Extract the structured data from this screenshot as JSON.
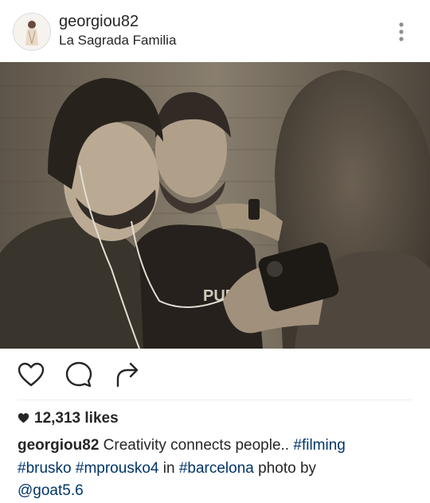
{
  "post": {
    "username": "georgiou82",
    "location": "La Sagrada Familia",
    "likes": "12,313 likes",
    "caption": {
      "username": "georgiou82",
      "text1": " Creativity connects people.. ",
      "tag1": "#filming",
      "tag2": "#brusko",
      "tag3": "#mprousko4",
      "text2": " in ",
      "tag4": "#barcelona",
      "text3": " photo by",
      "mention": "@goat5.6"
    }
  },
  "icons": {
    "more": "more-vertical-icon",
    "like": "heart-outline-icon",
    "comment": "comment-bubble-icon",
    "share": "share-arrow-icon",
    "likes_heart": "heart-filled-icon"
  },
  "colors": {
    "text": "#262626",
    "hashtag": "#003569",
    "photo_tint": "sepia"
  }
}
